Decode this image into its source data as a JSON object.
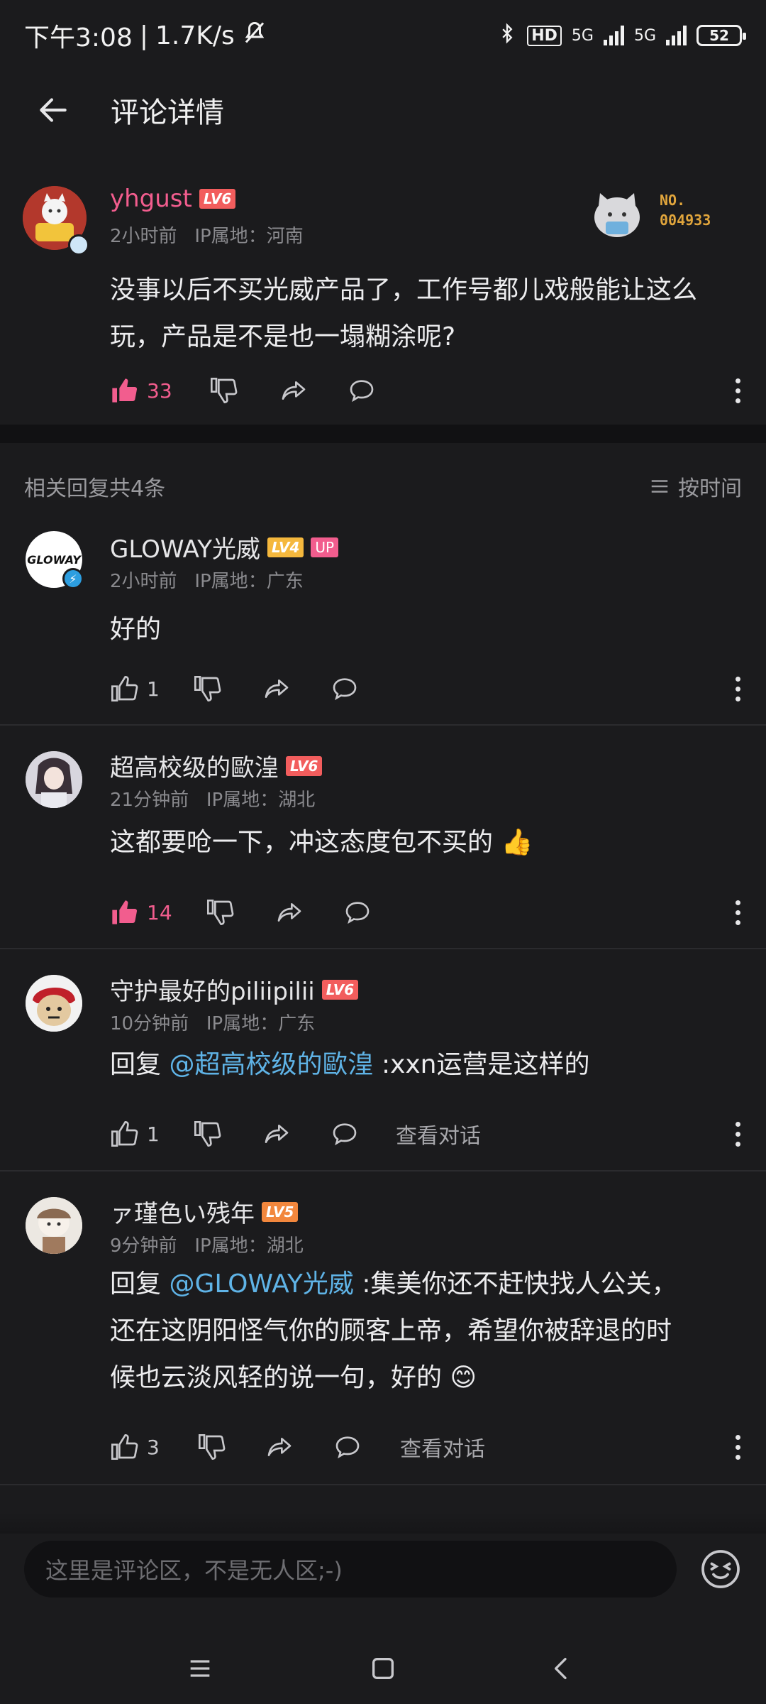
{
  "status": {
    "time": "下午3:08",
    "speed": "1.7K/s",
    "net1": "5G",
    "net2": "5G",
    "hd": "HD",
    "battery": "52"
  },
  "header": {
    "title": "评论详情"
  },
  "main_comment": {
    "username": "yhgust",
    "level": "LV6",
    "time": "2小时前",
    "ip": "IP属地：河南",
    "content": "没事以后不买光威产品了，工作号都儿戏般能让这么玩，产品是不是也一塌糊涂呢?",
    "fan_badge": "NO.",
    "fan_number": "004933",
    "likes": "33",
    "liked": true
  },
  "replies_header": {
    "count_label": "相关回复共4条",
    "sort_label": "按时间"
  },
  "replies": [
    {
      "username": "GLOWAY光威",
      "level": "LV4",
      "up": "UP",
      "avatar_text": "GLOWAY",
      "time": "2小时前",
      "ip": "IP属地：广东",
      "content": "好的",
      "likes": "1"
    },
    {
      "username": "超高校级的歐湟",
      "level": "LV6",
      "time": "21分钟前",
      "ip": "IP属地：湖北",
      "content": "这都要呛一下，冲这态度包不买的 👍",
      "likes": "14"
    },
    {
      "username": "守护最好的piliipilii",
      "level": "LV6",
      "time": "10分钟前",
      "ip": "IP属地：广东",
      "reply_prefix": "回复",
      "mention": "@超高校级的歐湟",
      "content": ":xxn运营是这样的",
      "likes": "1",
      "see_dialog": "查看对话"
    },
    {
      "username": "ァ瑾色い残年",
      "level": "LV5",
      "time": "9分钟前",
      "ip": "IP属地：湖北",
      "reply_prefix": "回复",
      "mention": "@GLOWAY光威",
      "content_line1": ":集美你还不赶快找人公关，",
      "content_line2": "还在这阴阳怪气你的顾客上帝，希望你被辞退的时",
      "content_line3": "候也云淡风轻的说一句，好的 😊",
      "likes": "3",
      "see_dialog": "查看对话"
    }
  ],
  "input": {
    "placeholder": "这里是评论区，不是无人区;-)"
  },
  "colors": {
    "accent": "#f25d8e",
    "mention": "#5fb3e6",
    "background": "#1b1b1d",
    "lv6": "#f25d5d",
    "lv5": "#f2873d",
    "lv4": "#f5b83d"
  }
}
